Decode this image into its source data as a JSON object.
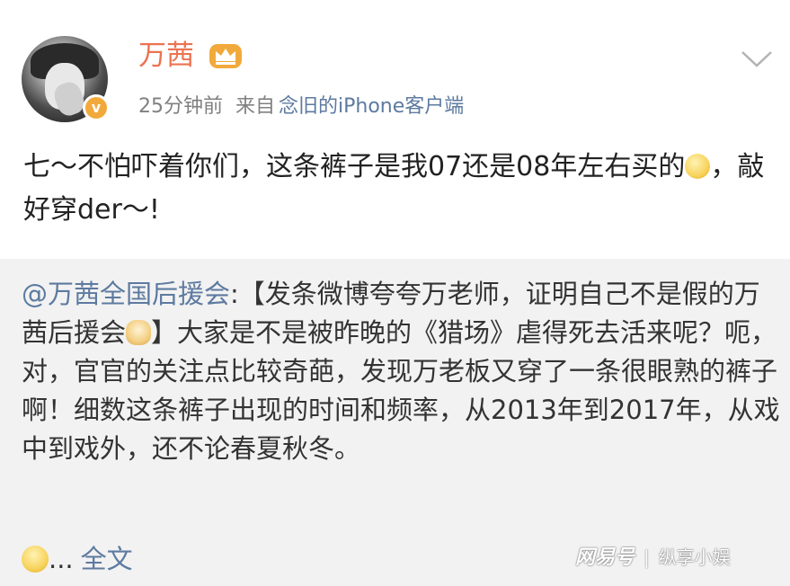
{
  "post": {
    "username": "万茜",
    "time": "25分钟前",
    "from_label": "来自",
    "source": "念旧的iPhone客户端",
    "text_part1": "七～不怕吓着你们，这条裤子是我07还是08年左右买的",
    "text_part2": "，敲好穿der～!",
    "icons": {
      "avatar": "avatar-image",
      "verified": "verified-badge-icon",
      "crown": "crown-icon",
      "menu": "chevron-down-icon",
      "emoji": "thinking-emoji-icon"
    }
  },
  "repost": {
    "mention": "@万茜全国后援会",
    "text_part1": ":【发条微博夸夸万老师，证明自己不是假的万茜后援会",
    "text_part2": "】大家是不是被昨晚的《猎场》虐得死去活来呢？呃，对，官官的关注点比较奇葩，发现万老板又穿了一条很眼熟的裤子啊！细数这条裤子出现的时间和频率，从2013年到2017年，从戏中到戏外，还不论春夏秋冬。",
    "ellipsis": "...",
    "fulltext_link": "全文",
    "icons": {
      "emoji_dog": "doge-emoji-icon",
      "emoji_laugh": "laughing-emoji-icon"
    }
  },
  "watermark": {
    "logo": "网易号",
    "separator": "|",
    "author": "纵享小娱"
  },
  "colors": {
    "username": "#eb7350",
    "link": "#5d7aa0",
    "meta_gray": "#808080",
    "repost_bg": "#f2f2f2",
    "badge": "#f2a93b"
  }
}
